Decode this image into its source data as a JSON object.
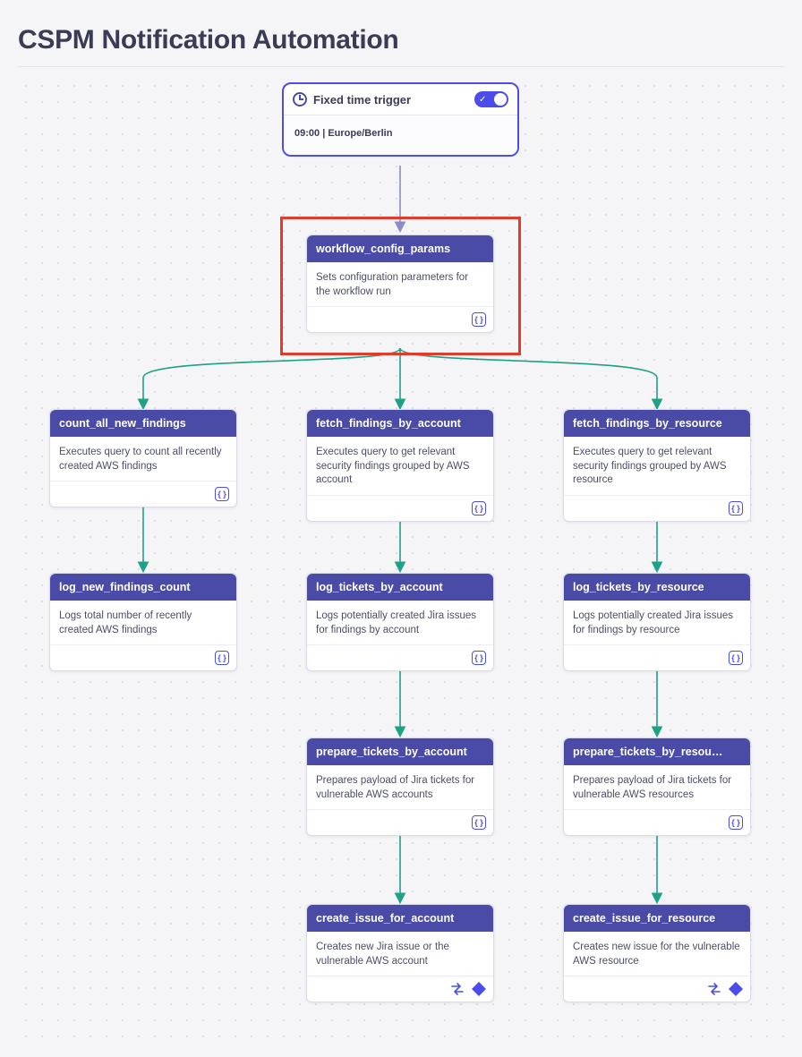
{
  "title": "CSPM Notification Automation",
  "trigger": {
    "label": "Fixed time trigger",
    "time": "09:00 | Europe/Berlin"
  },
  "nodes": {
    "workflow_config_params": {
      "title": "workflow_config_params",
      "desc": "Sets configuration parameters for the workflow run"
    },
    "count_all_new_findings": {
      "title": "count_all_new_findings",
      "desc": "Executes query to count all recently created AWS findings"
    },
    "fetch_findings_by_account": {
      "title": "fetch_findings_by_account",
      "desc": "Executes query to get relevant security findings grouped by AWS account"
    },
    "fetch_findings_by_resource": {
      "title": "fetch_findings_by_resource",
      "desc": "Executes query to get relevant security findings grouped by AWS resource"
    },
    "log_new_findings_count": {
      "title": "log_new_findings_count",
      "desc": "Logs total number of recently created AWS findings"
    },
    "log_tickets_by_account": {
      "title": "log_tickets_by_account",
      "desc": "Logs potentially created Jira issues for findings by account"
    },
    "log_tickets_by_resource": {
      "title": "log_tickets_by_resource",
      "desc": "Logs potentially created Jira issues for findings by resource"
    },
    "prepare_tickets_by_account": {
      "title": "prepare_tickets_by_account",
      "desc": "Prepares payload of Jira tickets for vulnerable AWS accounts"
    },
    "prepare_tickets_by_resource": {
      "title": "prepare_tickets_by_resou…",
      "desc": "Prepares payload of Jira tickets for vulnerable AWS resources"
    },
    "create_issue_for_account": {
      "title": "create_issue_for_account",
      "desc": "Creates new Jira issue or the vulnerable AWS account"
    },
    "create_issue_for_resource": {
      "title": "create_issue_for_resource",
      "desc": "Creates new issue for the vulnerable AWS resource"
    }
  }
}
